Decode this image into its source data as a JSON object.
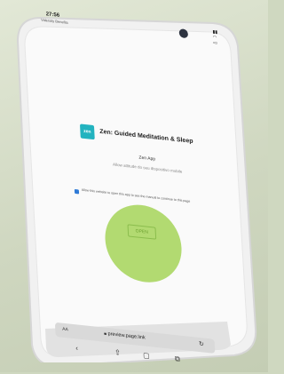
{
  "status_bar": {
    "time": "27:56",
    "carrier": "Valersity Benefits",
    "icons": "signal-wifi-battery"
  },
  "app": {
    "icon_label": "zen",
    "title": "Zen: Guided Meditation & Sleep",
    "subtitle": "Zen App",
    "description": "Allow attitude do seu dispositivo mobile"
  },
  "consent": {
    "text": "Allow this website to open this app to see the manual to continue to this page"
  },
  "open_button": {
    "label": "OPEN"
  },
  "browser": {
    "aa_label": "AA",
    "url": "preview.page.link",
    "lock_icon": "lock-icon",
    "reload_icon": "reload-icon"
  },
  "toolbar": {
    "back_icon": "back-icon",
    "share_icon": "share-icon",
    "bookmarks_icon": "bookmarks-icon",
    "tabs_icon": "tabs-icon"
  },
  "colors": {
    "background": "#cfd8c0",
    "app_icon": "#22b3bf",
    "tap_highlight": "#96cd3c",
    "checkbox": "#2f7ad6"
  }
}
